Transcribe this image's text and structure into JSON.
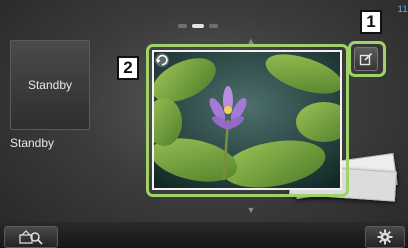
{
  "status": {
    "clock": "11"
  },
  "pager": {
    "pages": 3,
    "active": 1
  },
  "source_tile": {
    "label": "Standby"
  },
  "source_name": {
    "label": "Standby"
  },
  "callouts": {
    "one": "1",
    "two": "2"
  },
  "icons": {
    "edit": "edit-icon",
    "rotate": "rotate-icon",
    "source_select": "source-search-icon",
    "settings": "gear-icon",
    "scroll_up": "chevron-up-icon",
    "scroll_down": "chevron-down-icon"
  },
  "colors": {
    "callout_frame": "#9fd36a",
    "clock": "#6bb9e0"
  }
}
